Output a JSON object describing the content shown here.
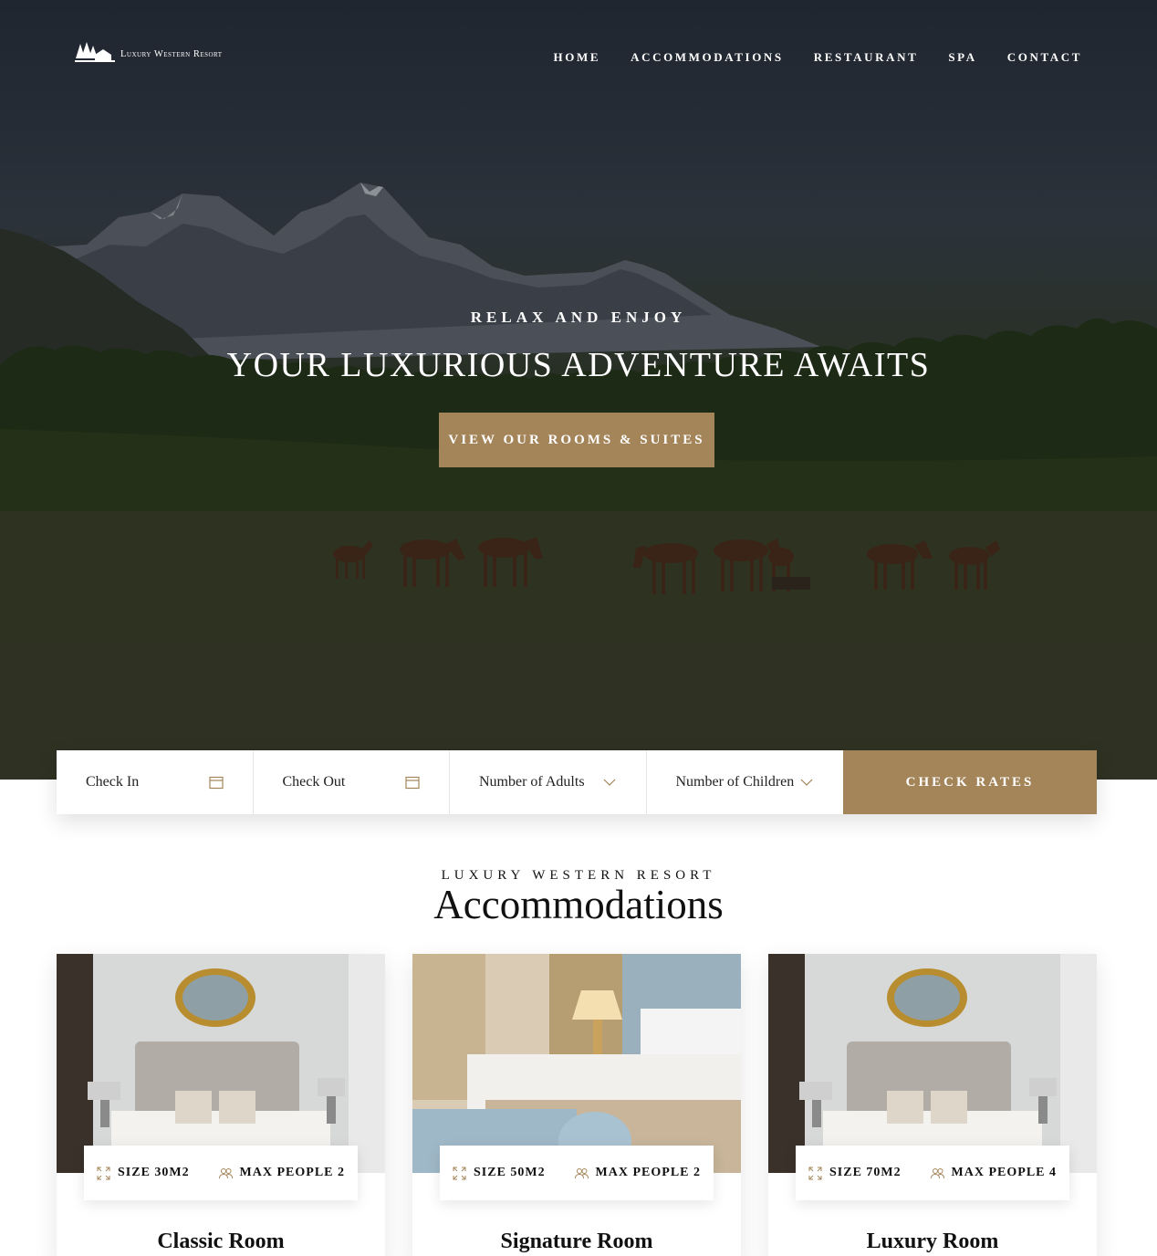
{
  "brand": {
    "name": "Luxury Western Resort"
  },
  "nav": {
    "items": [
      "HOME",
      "ACCOMMODATIONS",
      "RESTAURANT",
      "SPA",
      "CONTACT"
    ]
  },
  "hero": {
    "subtitle": "RELAX AND ENJOY",
    "title": "YOUR LUXURIOUS ADVENTURE AWAITS",
    "cta_label": "VIEW OUR ROOMS & SUITES"
  },
  "booking": {
    "check_in": "Check In",
    "check_out": "Check Out",
    "adults": "Number of Adults",
    "children": "Number of Children",
    "submit_label": "CHECK RATES"
  },
  "section": {
    "kicker": "LUXURY WESTERN RESORT",
    "title": "Accommodations"
  },
  "rooms": [
    {
      "name": "Classic Room",
      "size": "SIZE 30M2",
      "people": "MAX PEOPLE 2"
    },
    {
      "name": "Signature Room",
      "size": "SIZE 50M2",
      "people": "MAX PEOPLE 2"
    },
    {
      "name": "Luxury Room",
      "size": "SIZE 70M2",
      "people": "MAX PEOPLE 4"
    }
  ],
  "colors": {
    "accent": "#a4855a",
    "text": "#111111",
    "white": "#ffffff"
  },
  "icons": [
    "calendar-icon",
    "chevron-down-icon",
    "expand-icon",
    "people-icon",
    "logo-trees-icon"
  ]
}
